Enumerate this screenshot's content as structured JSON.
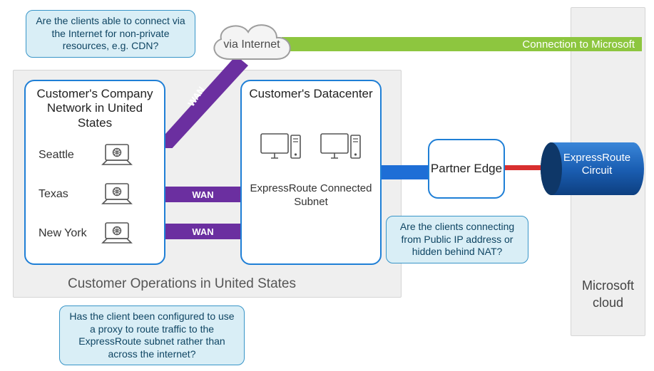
{
  "callouts": {
    "internet_clients": "Are the clients able to connect via the Internet for non-private resources, e.g. CDN?",
    "proxy_config": "Has the client been configured to use a proxy to route traffic to the ExpressRoute subnet rather than across the internet?",
    "nat_question": "Are the clients connecting from Public IP address or hidden behind NAT?"
  },
  "cloud": {
    "label": "via Internet"
  },
  "green_bar": "Connection to Microsoft",
  "company_network": {
    "title": "Customer's Company Network in United States",
    "locations": [
      "Seattle",
      "Texas",
      "New York"
    ]
  },
  "datacenter": {
    "title": "Customer's Datacenter",
    "subnet": "ExpressRoute Connected Subnet"
  },
  "wan_label": "WAN",
  "operations_label": "Customer Operations in United States",
  "partner_edge": "Partner Edge",
  "expressroute_circuit": "ExpressRoute Circuit",
  "ms_cloud": "Microsoft cloud",
  "colors": {
    "border_blue": "#1f7fd6",
    "wan_purple": "#6b2fa0",
    "link_green": "#8dc63f",
    "link_red": "#d82f2f",
    "callout_bg": "#d9eef6",
    "callout_border": "#3895c8",
    "cyl_blue": "#1b5fb4"
  }
}
